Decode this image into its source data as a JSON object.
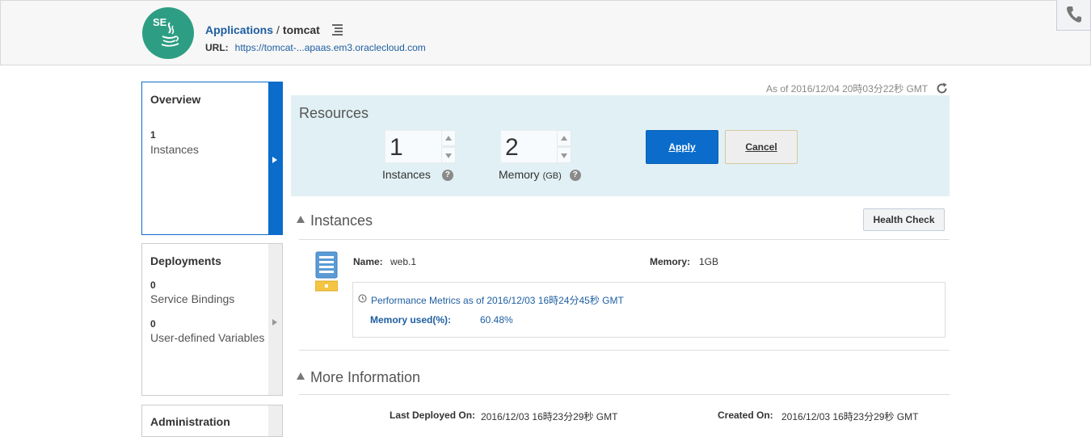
{
  "header": {
    "logo_text": "SE",
    "breadcrumb_parent": "Applications",
    "breadcrumb_sep": "/",
    "breadcrumb_current": "tomcat",
    "url_label": "URL:",
    "url_value": "https://tomcat-...apaas.em3.oraclecloud.com"
  },
  "sidebar": {
    "items": [
      {
        "title": "Overview",
        "stats": [
          {
            "count": "1",
            "label": "Instances"
          }
        ]
      },
      {
        "title": "Deployments",
        "stats": [
          {
            "count": "0",
            "label": "Service Bindings"
          },
          {
            "count": "0",
            "label": "User-defined Variables"
          }
        ]
      },
      {
        "title": "Administration"
      }
    ]
  },
  "timestamp": "As of 2016/12/04 20時03分22秒 GMT",
  "resources": {
    "title": "Resources",
    "instances_value": "1",
    "instances_label": "Instances",
    "memory_value": "2",
    "memory_label": "Memory",
    "memory_unit": "(GB)",
    "help_glyph": "?",
    "apply_label": "Apply",
    "cancel_label": "Cancel"
  },
  "instances": {
    "title": "Instances",
    "health_check_label": "Health Check",
    "name_label": "Name:",
    "name_value": "web.1",
    "memory_label": "Memory:",
    "memory_value": "1GB",
    "metrics_heading": "Performance Metrics as of 2016/12/03 16時24分45秒 GMT",
    "memory_used_label": "Memory used(%):",
    "memory_used_value": "60.48%"
  },
  "more_info": {
    "title": "More Information",
    "last_deployed_label": "Last Deployed On:",
    "last_deployed_value": "2016/12/03 16時23分29秒 GMT",
    "created_label": "Created On:",
    "created_value": "2016/12/03 16時23分29秒 GMT"
  },
  "colors": {
    "accent": "#0b6ccb",
    "logo_bg": "#2d9e83",
    "resources_bg": "#e1f0f4",
    "link": "#1e5ea0"
  }
}
